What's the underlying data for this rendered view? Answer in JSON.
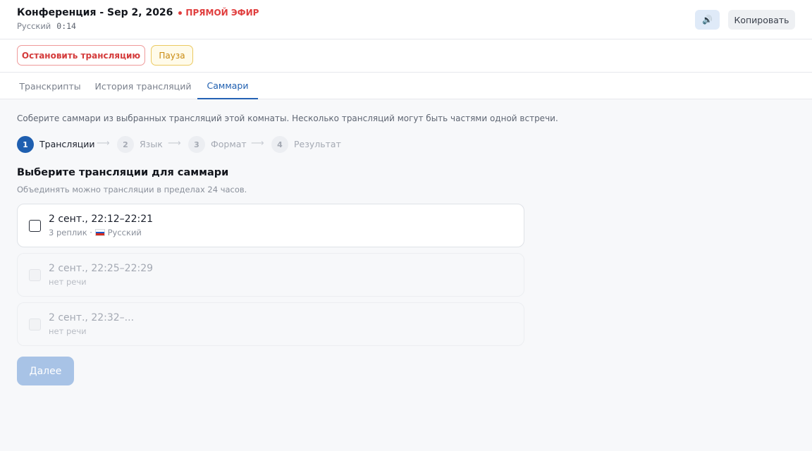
{
  "header": {
    "title": "Конференция - Sep 2, 2026",
    "live_label": "ПРЯМОЙ ЭФИР",
    "language": "Русский",
    "timer": "0:14",
    "speaker_icon": "🔊",
    "copy_label": "Копировать"
  },
  "controls": {
    "stop_label": "Остановить трансляцию",
    "pause_label": "Пауза"
  },
  "tabs": [
    {
      "label": "Транскрипты",
      "active": false
    },
    {
      "label": "История трансляций",
      "active": false
    },
    {
      "label": "Саммари",
      "active": true
    }
  ],
  "intro": "Соберите саммари из выбранных трансляций этой комнаты. Несколько трансляций могут быть частями одной встречи.",
  "stepper": {
    "arrow": "⟶",
    "steps": [
      {
        "number": "1",
        "label": "Трансляции",
        "active": true
      },
      {
        "number": "2",
        "label": "Язык",
        "active": false
      },
      {
        "number": "3",
        "label": "Формат",
        "active": false
      },
      {
        "number": "4",
        "label": "Результат",
        "active": false
      }
    ]
  },
  "section": {
    "title": "Выберите трансляции для саммари",
    "hint": "Объединять можно трансляции в пределах 24 часов."
  },
  "broadcasts": [
    {
      "title": "2 сент., 22:12–22:21",
      "meta": "3 реплик · ",
      "language": "Русский",
      "flag_colors": [
        "#ffffff",
        "#1c57c7",
        "#d52b1e"
      ],
      "enabled": true,
      "checked": false
    },
    {
      "title": "2 сент., 22:25–22:29",
      "meta": "нет речи",
      "enabled": false,
      "checked": false
    },
    {
      "title": "2 сент., 22:32–...",
      "meta": "нет речи",
      "enabled": false,
      "checked": false
    }
  ],
  "next_label": "Далее",
  "colors": {
    "accent": "#1f5fb0",
    "live": "#e03d3d",
    "stop": "#d43b3b",
    "pause": "#c98a10",
    "next_disabled": "#a8c3e6"
  }
}
